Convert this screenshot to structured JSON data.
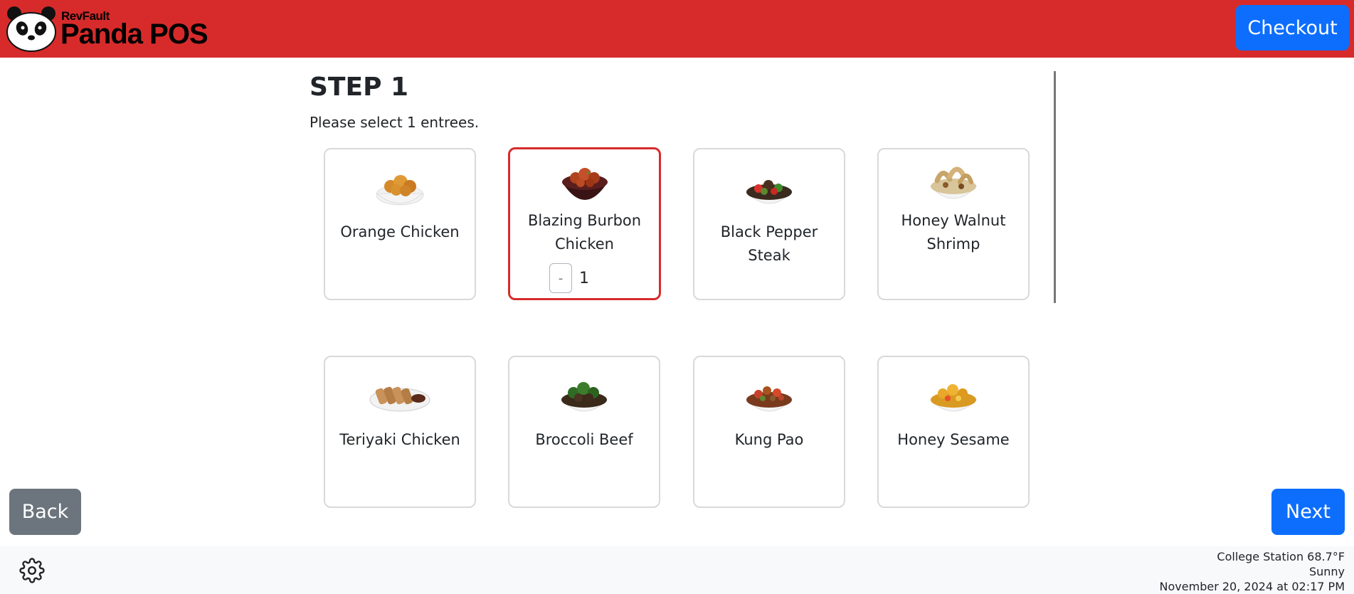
{
  "header": {
    "brand_small": "RevFault",
    "brand_big": "Panda POS",
    "checkout_label": "Checkout"
  },
  "step": {
    "title": "STEP 1",
    "instruction": "Please select 1 entrees."
  },
  "entrees": [
    {
      "name": "Orange Chicken",
      "icon": "orange-chicken-bowl-icon",
      "selected": false
    },
    {
      "name": "Blazing Burbon Chicken",
      "icon": "blazing-burbon-chicken-bowl-icon",
      "selected": true,
      "quantity": "1",
      "minus_label": "-"
    },
    {
      "name": "Black Pepper Steak",
      "icon": "black-pepper-steak-bowl-icon",
      "selected": false
    },
    {
      "name": "Honey Walnut Shrimp",
      "icon": "honey-walnut-shrimp-bowl-icon",
      "selected": false
    },
    {
      "name": "Teriyaki Chicken",
      "icon": "teriyaki-chicken-plate-icon",
      "selected": false
    },
    {
      "name": "Broccoli Beef",
      "icon": "broccoli-beef-bowl-icon",
      "selected": false
    },
    {
      "name": "Kung Pao",
      "icon": "kung-pao-bowl-icon",
      "selected": false
    },
    {
      "name": "Honey Sesame",
      "icon": "honey-sesame-bowl-icon",
      "selected": false
    }
  ],
  "nav": {
    "back_label": "Back",
    "next_label": "Next"
  },
  "footer": {
    "weather_line": "College Station 68.7°F",
    "condition": "Sunny",
    "datetime": "November 20, 2024 at 02:17 PM"
  },
  "colors": {
    "header_red": "#d72b2b",
    "primary_blue": "#0d6efd",
    "secondary_gray": "#6c757d",
    "selected_border": "#d72b2b"
  }
}
